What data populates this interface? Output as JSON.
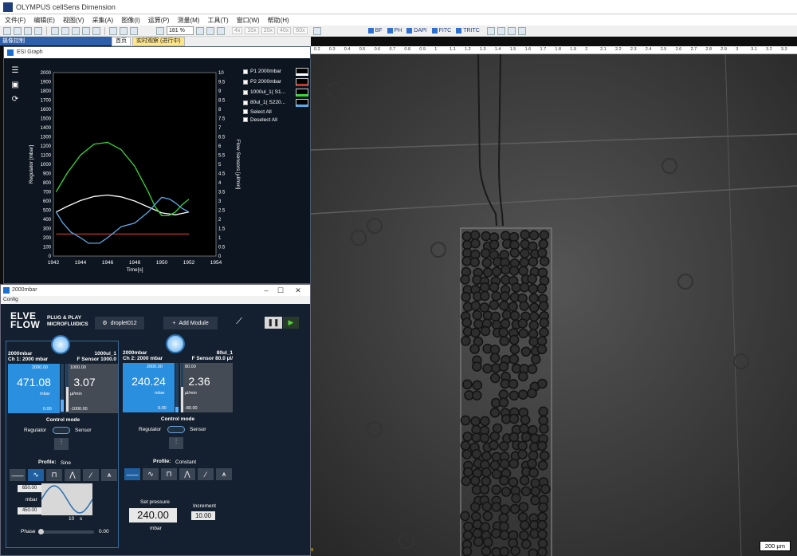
{
  "app": {
    "title": "OLYMPUS cellSens Dimension",
    "menu": [
      "文件(F)",
      "编辑(E)",
      "视图(V)",
      "采集(A)",
      "图像(I)",
      "运算(P)",
      "测量(M)",
      "工具(T)",
      "窗口(W)",
      "帮助(H)"
    ],
    "zoom": "181 %",
    "magnifications": [
      "4x",
      "10x",
      "20x",
      "40x",
      "60x"
    ],
    "filters": [
      "BF",
      "PH",
      "DAPI",
      "FITC",
      "TRITC"
    ]
  },
  "dock": {
    "title": "摄像控制",
    "tabs": [
      "首页",
      "实时观察 (进行中)"
    ]
  },
  "esi_graph": {
    "title": "ESI Graph",
    "legend": [
      "P1 2000mbar",
      "P2 2000mbar",
      "1000ul_1( S1...",
      "80ul_1( S220..."
    ],
    "select_all": "Select All",
    "deselect_all": "Deselect All",
    "chart_data": {
      "type": "line",
      "xlabel": "Time[s]",
      "ylabel": "Regulator [mbar]",
      "y2label": "Flow Sensors [µl/min]",
      "xlim": [
        1942,
        1954
      ],
      "ylim": [
        0,
        2000
      ],
      "y2lim": [
        0,
        10
      ],
      "xticks": [
        "1942",
        "1944",
        "1946",
        "1948",
        "1950",
        "1952",
        "1954"
      ],
      "yticks": [
        "0",
        "100",
        "200",
        "300",
        "400",
        "500",
        "600",
        "700",
        "800",
        "900",
        "1000",
        "1100",
        "1200",
        "1300",
        "1400",
        "1500",
        "1600",
        "1700",
        "1800",
        "1900",
        "2000"
      ],
      "y2ticks": [
        "0",
        "0.5",
        "1",
        "1.5",
        "2",
        "2.5",
        "3",
        "3.5",
        "4",
        "4.5",
        "5",
        "5.5",
        "6",
        "6.5",
        "7",
        "7.5",
        "8",
        "8.5",
        "9",
        "9.5",
        "10"
      ],
      "series": [
        {
          "name": "P1 2000mbar",
          "color": "#ffffff",
          "axis": "left",
          "x": [
            1942.2,
            1943,
            1944,
            1945,
            1946,
            1947,
            1948,
            1949,
            1950,
            1951,
            1952
          ],
          "y": [
            480,
            540,
            605,
            650,
            665,
            645,
            600,
            535,
            470,
            450,
            480
          ]
        },
        {
          "name": "P2 2000mbar",
          "color": "#c0392b",
          "axis": "left",
          "x": [
            1942.2,
            1952
          ],
          "y": [
            240,
            240
          ]
        },
        {
          "name": "1000ul_1( S1...",
          "color": "#38d838",
          "axis": "right",
          "x": [
            1942.2,
            1943,
            1944,
            1945,
            1946,
            1947,
            1948,
            1948.5,
            1949,
            1949.5,
            1950,
            1950.5,
            1951,
            1951.5,
            1952
          ],
          "y": [
            3.5,
            4.5,
            5.5,
            6.1,
            6.2,
            5.8,
            4.9,
            4.2,
            3.5,
            2.7,
            2.2,
            2.2,
            2.4,
            2.8,
            3.1
          ]
        },
        {
          "name": "80ul_1( S220...",
          "color": "#5aaae8",
          "axis": "right",
          "x": [
            1942.2,
            1942.7,
            1943.3,
            1944,
            1944.6,
            1945.4,
            1946,
            1947,
            1948,
            1949,
            1949.6,
            1950,
            1950.6,
            1951,
            1951.5,
            1952
          ],
          "y": [
            2.4,
            1.8,
            1.3,
            1.0,
            0.7,
            0.7,
            1.0,
            1.6,
            1.8,
            2.4,
            2.9,
            3.2,
            3.1,
            2.9,
            2.6,
            2.4
          ]
        }
      ]
    }
  },
  "elveflow": {
    "title": "2000mbar",
    "config": "Config",
    "logo": [
      "ELVE",
      "FLOW"
    ],
    "tagline": [
      "PLUG & PLAY",
      "MICROFLUIDICS"
    ],
    "device": "droplet012",
    "add_module": "Add Module",
    "channels": [
      {
        "name": "2000mbar",
        "ch_label": "Ch 1: 2000 mbar",
        "sensor_name": "1000ul_1",
        "sensor_label": "F Sensor 1000.0",
        "pressure": "471.08",
        "pressure_unit": "mbar",
        "pressure_max": "2000.00",
        "pressure_min": "0.00",
        "pressure_level": 0.2355,
        "flow": "3.07",
        "flow_unit": "µl/min",
        "flow_max": "1000.00",
        "flow_min": "-1000.00",
        "flow_level": 0.5015,
        "control_mode": "Control mode",
        "regulator": "Regulator",
        "sensor": "Sensor",
        "profile_label": "Profile:",
        "profile": "Sine",
        "max": "650.00",
        "unit": "mbar",
        "min": "450.00",
        "period": "10",
        "period_unit": "s",
        "phase_label": "Phase",
        "phase": "0.00"
      },
      {
        "name": "2000mbar",
        "ch_label": "Ch 2: 2000 mbar",
        "sensor_name": "80ul_1",
        "sensor_label": "F Sensor 80.0 µl/",
        "pressure": "240.24",
        "pressure_unit": "mbar",
        "pressure_max": "2000.00",
        "pressure_min": "0.00",
        "pressure_level": 0.1201,
        "flow": "2.36",
        "flow_unit": "µl/min",
        "flow_max": "80.00",
        "flow_min": "-80.00",
        "flow_level": 0.5148,
        "control_mode": "Control mode",
        "regulator": "Regulator",
        "sensor": "Sensor",
        "profile_label": "Profile:",
        "profile": "Constant",
        "set_pressure_label": "Set pressure",
        "set_pressure": "240.00",
        "set_unit": "mbar",
        "increment_label": "Increment",
        "increment": "10.00"
      }
    ]
  },
  "microscope": {
    "ruler": [
      "0.2",
      "0.3",
      "0.4",
      "0.5",
      "0.6",
      "0.7",
      "0.8",
      "0.9",
      "1",
      "1.1",
      "1.2",
      "1.3",
      "1.4",
      "1.5",
      "1.6",
      "1.7",
      "1.8",
      "1.9",
      "2",
      "2.1",
      "2.2",
      "2.3",
      "2.4",
      "2.5",
      "2.6",
      "2.7",
      "2.8",
      "2.9",
      "3",
      "3.1",
      "3.2",
      "3.3"
    ],
    "scale_bar": "200 µm",
    "objective": "4 x"
  }
}
